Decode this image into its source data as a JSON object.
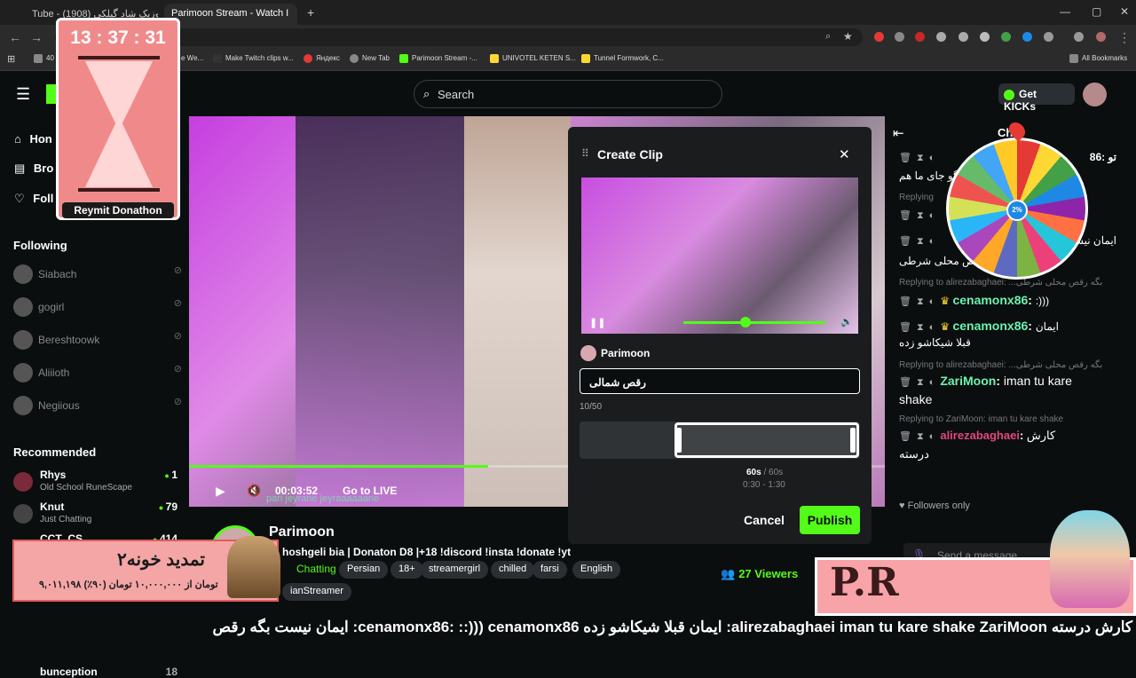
{
  "browser": {
    "tabs": [
      {
        "label": "Tube - موزیک شاد گیلکی (1908)",
        "active": false
      },
      {
        "label": "Parimoon Stream - Watch I",
        "active": true
      }
    ],
    "new_tab": "+",
    "bookmarks": [
      "40",
      "e We...",
      "Make Twitch clips w...",
      "Яндекс",
      "New Tab",
      "Parimoon Stream -...",
      "UNIVOTEL KETEN S...",
      "Tunnel Formwork, C..."
    ],
    "all_bookmarks": "All Bookmarks"
  },
  "header": {
    "search_placeholder": "Search",
    "get_kicks": "Get KICKs"
  },
  "sidebar": {
    "nav": [
      "Hon",
      "Bro",
      "Foll"
    ],
    "following_title": "Following",
    "following": [
      "Siabach",
      "gogirl",
      "Bereshtoowk",
      "Aliiioth",
      "Negiious"
    ],
    "recommended_title": "Recommended",
    "recommended": [
      {
        "name": "Rhys",
        "category": "Old School RuneScape",
        "viewers": "1"
      },
      {
        "name": "Knut",
        "category": "Just Chatting",
        "viewers": "79"
      },
      {
        "name": "CCT_CS",
        "category": "",
        "viewers": "414"
      },
      {
        "name": "bunception",
        "category": "",
        "viewers": "18"
      }
    ]
  },
  "player": {
    "time": "00:03:52",
    "go_live": "Go to LIVE",
    "overlay_text": "pari jeyrane jeyraaaaaane",
    "progress": 0.43
  },
  "stream": {
    "channel": "Parimoon",
    "title": "hoshgeli bia | Donaton D8 |+18 !discord !insta !donate !yt",
    "category": "Chatting",
    "tags": [
      "Persian",
      "18+",
      "streamergirl",
      "chilled",
      "farsi",
      "English"
    ],
    "badge": "ianStreamer",
    "viewers": "27 Viewers"
  },
  "clip_modal": {
    "title": "Create Clip",
    "streamer": "Parimoon",
    "clip_title": "رقص شمالی",
    "char_count": "10/50",
    "duration": "60s",
    "duration_max": "/ 60s",
    "range": "0:30 - 1:30",
    "cancel": "Cancel",
    "publish": "Publish",
    "preview_progress": 0.6
  },
  "chat": {
    "title": "Chat",
    "messages": [
      {
        "type": "msg",
        "text": "تو :86"
      },
      {
        "type": "msg",
        "text": "گو جای ما هم"
      },
      {
        "type": "reply",
        "text": "Replying"
      },
      {
        "type": "msg",
        "text": "ایمان نیست"
      },
      {
        "type": "msg",
        "text": "بگه رقص محلی شرطی"
      },
      {
        "type": "reply",
        "text": "Replying to alirezabaghaei: ...بگه رقص محلی شرطی"
      },
      {
        "type": "user",
        "user": "cenamonx86",
        "text": ":)))"
      },
      {
        "type": "user",
        "user": "cenamonx86",
        "text": "ایمان"
      },
      {
        "type": "msg",
        "text": "قبلا شیکاشو زده"
      },
      {
        "type": "reply",
        "text": "Replying to alirezabaghaei: ...بگه رقص محلی شرطی"
      },
      {
        "type": "user",
        "user": "ZariMoon",
        "text": "iman tu kare"
      },
      {
        "type": "msg",
        "text": "shake"
      },
      {
        "type": "reply",
        "text": "Replying to ZariMoon: iman tu kare shake"
      },
      {
        "type": "user",
        "user": "alirezabaghaei",
        "text": "کارش"
      },
      {
        "type": "msg",
        "text": "درسته"
      }
    ],
    "followers_only": "Followers only",
    "send_placeholder": "Send a message"
  },
  "overlays": {
    "timer": "13 : 37 : 31",
    "timer_label": "Reymit Donathon",
    "donation_title": "تمدید خونه۲",
    "donation_sub": "۹,۰۱۱,۱۹۸ تومان از ۱۰,۰۰۰,۰۰۰ تومان (۹۰٪)",
    "ticker": "کارش درسته  alirezabaghaei  iman tu kare shake  ZariMoon:  ایمان قبلا شیکاشو زده  cenamonx86:  ::)))  cenamonx86:  ایمان نیست بگه رقص",
    "brand": "P.R",
    "wheel_center": "2%"
  },
  "colors": {
    "accent": "#53fc18",
    "cenamon": "#6cf3b0",
    "alireza": "#e2487a",
    "zari": "#6cf3b0"
  }
}
